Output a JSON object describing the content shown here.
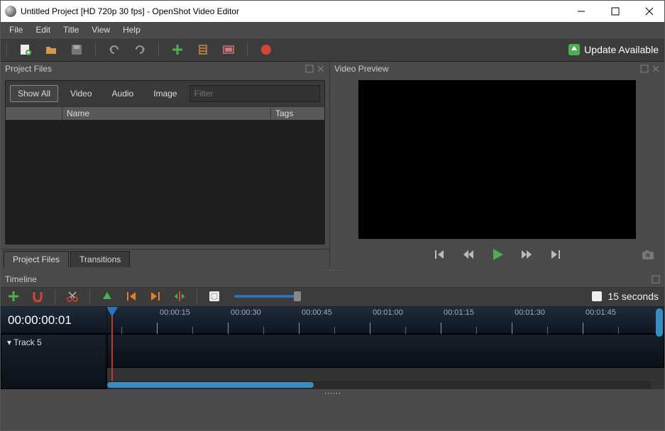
{
  "window_title": "Untitled Project [HD 720p 30 fps] - OpenShot Video Editor",
  "menu": {
    "file": "File",
    "edit": "Edit",
    "title": "Title",
    "view": "View",
    "help": "Help"
  },
  "toolbar": {
    "update_label": "Update Available"
  },
  "project_files": {
    "panel_title": "Project Files",
    "tabs": {
      "show_all": "Show All",
      "video": "Video",
      "audio": "Audio",
      "image": "Image"
    },
    "filter_placeholder": "Filter",
    "columns": {
      "name": "Name",
      "tags": "Tags"
    },
    "bottom_tabs": {
      "project_files": "Project Files",
      "transitions": "Transitions"
    }
  },
  "video_preview": {
    "panel_title": "Video Preview"
  },
  "timeline": {
    "panel_title": "Timeline",
    "timecode": "00:00:00:01",
    "tracks": [
      "Track 5"
    ],
    "zoom_label": "15 seconds",
    "ticks": [
      "00:00:15",
      "00:00:30",
      "00:00:45",
      "00:01:00",
      "00:01:15",
      "00:01:30",
      "00:01:45"
    ]
  },
  "colors": {
    "accent": "#2e71b8",
    "play": "#4caf50",
    "record": "#d64531"
  }
}
